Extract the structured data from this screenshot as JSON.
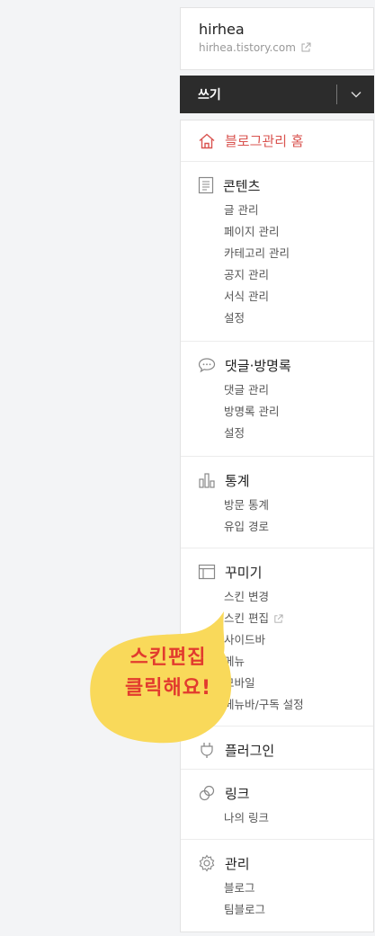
{
  "blog": {
    "name": "hirhea",
    "url": "hirhea.tistory.com",
    "url_icon": "external-link-icon"
  },
  "write": {
    "label": "쓰기",
    "toggle_icon": "chevron-down-icon"
  },
  "menu": {
    "home": {
      "label": "블로그관리 홈",
      "icon": "home-icon",
      "color": "#d9534f"
    },
    "sections": [
      {
        "title": "콘텐츠",
        "icon": "document-icon",
        "items": [
          "글 관리",
          "페이지 관리",
          "카테고리 관리",
          "공지 관리",
          "서식 관리",
          "설정"
        ]
      },
      {
        "title": "댓글·방명록",
        "icon": "comment-icon",
        "items": [
          "댓글 관리",
          "방명록 관리",
          "설정"
        ]
      },
      {
        "title": "통계",
        "icon": "bar-chart-icon",
        "items": [
          "방문 통계",
          "유입 경로"
        ]
      },
      {
        "title": "꾸미기",
        "icon": "layout-icon",
        "items": [
          "스킨 변경",
          "스킨 편집",
          "사이드바",
          "메뉴",
          "모바일",
          "메뉴바/구독 설정"
        ]
      },
      {
        "title": "플러그인",
        "icon": "plug-icon",
        "items": []
      },
      {
        "title": "링크",
        "icon": "link-icon",
        "items": [
          "나의 링크"
        ]
      },
      {
        "title": "관리",
        "icon": "gear-icon",
        "items": [
          "블로그",
          "팀블로그"
        ]
      }
    ]
  },
  "annotation": {
    "line1": "스킨편집",
    "line2": "클릭해요!",
    "bubble_color": "#f9d95a",
    "text_color": "#e23b2e"
  }
}
